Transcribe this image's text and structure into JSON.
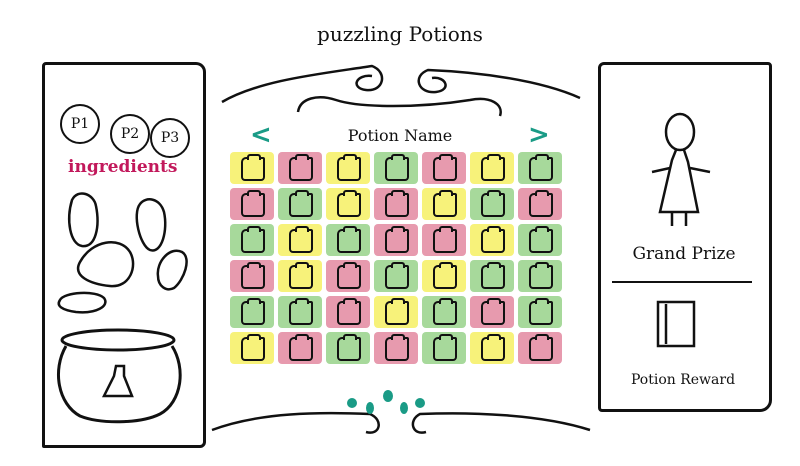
{
  "title": "puzzling Potions",
  "players": [
    "P1",
    "P2",
    "P3"
  ],
  "ingredients_label": "ingredients",
  "potion_name": "Potion Name",
  "nav": {
    "prev": "<",
    "next": ">"
  },
  "grand_prize_label": "Grand Prize",
  "potion_reward_label": "Potion Reward",
  "colors": {
    "yellow": "#f7f27a",
    "pink": "#e79aae",
    "green": "#a7d99b",
    "accent": "#1a9b86",
    "ingredients": "#c2185b"
  },
  "icons": [
    "ingredient-blob-icon",
    "cauldron-icon",
    "potion-bottle-icon",
    "stick-figure-icon",
    "reward-card-icon",
    "swirl-decoration-icon"
  ],
  "board": [
    [
      "yellow",
      "pink",
      "yellow",
      "green",
      "pink",
      "yellow",
      "green"
    ],
    [
      "pink",
      "green",
      "yellow",
      "pink",
      "yellow",
      "green",
      "pink"
    ],
    [
      "green",
      "yellow",
      "green",
      "pink",
      "pink",
      "yellow",
      "green"
    ],
    [
      "pink",
      "yellow",
      "pink",
      "green",
      "yellow",
      "green",
      "green"
    ],
    [
      "green",
      "green",
      "pink",
      "yellow",
      "green",
      "pink",
      "green"
    ],
    [
      "yellow",
      "pink",
      "green",
      "pink",
      "green",
      "yellow",
      "pink"
    ]
  ]
}
